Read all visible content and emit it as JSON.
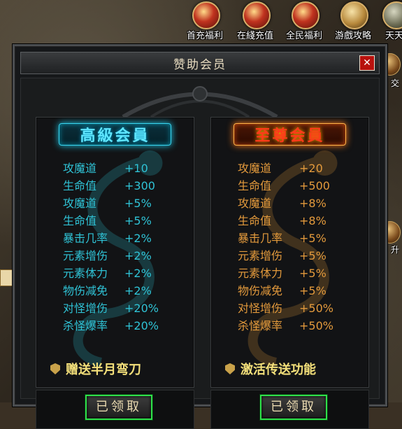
{
  "top_bar": {
    "items": [
      {
        "label": "首充福利",
        "icon": "gift-box-icon"
      },
      {
        "label": "在綫充值",
        "icon": "recharge-icon"
      },
      {
        "label": "全民福利",
        "icon": "red-pouch-icon"
      },
      {
        "label": "游戲攻略",
        "icon": "scroll-icon"
      },
      {
        "label": "天天",
        "icon": "calendar-icon"
      }
    ]
  },
  "right_side": {
    "labels": [
      "交",
      "升"
    ]
  },
  "dialog": {
    "title": "赞助会员",
    "close_label": "✕"
  },
  "cards": [
    {
      "tier": "高級会員",
      "theme_color": "#2fc3d6",
      "stats": [
        {
          "name": "攻魔道",
          "value": "+10"
        },
        {
          "name": "生命值",
          "value": "+300"
        },
        {
          "name": "攻魔道",
          "value": "+5%"
        },
        {
          "name": "生命值",
          "value": "+5%"
        },
        {
          "name": "暴击几率",
          "value": "+2%"
        },
        {
          "name": "元素增伤",
          "value": "+2%"
        },
        {
          "name": "元素体力",
          "value": "+2%"
        },
        {
          "name": "物伤减免",
          "value": "+2%"
        },
        {
          "name": "对怪增伤",
          "value": "+20%"
        },
        {
          "name": "杀怪爆率",
          "value": "+20%"
        }
      ],
      "bonus": "赠送半月弯刀",
      "button": "已领取"
    },
    {
      "tier": "至尊会員",
      "theme_color": "#e39a3c",
      "stats": [
        {
          "name": "攻魔道",
          "value": "+20"
        },
        {
          "name": "生命值",
          "value": "+500"
        },
        {
          "name": "攻魔道",
          "value": "+8%"
        },
        {
          "name": "生命值",
          "value": "+8%"
        },
        {
          "name": "暴击几率",
          "value": "+5%"
        },
        {
          "name": "元素增伤",
          "value": "+5%"
        },
        {
          "name": "元素体力",
          "value": "+5%"
        },
        {
          "name": "物伤减免",
          "value": "+5%"
        },
        {
          "name": "对怪增伤",
          "value": "+50%"
        },
        {
          "name": "杀怪爆率",
          "value": "+50%"
        }
      ],
      "bonus": "激活传送功能",
      "button": "已领取"
    }
  ]
}
